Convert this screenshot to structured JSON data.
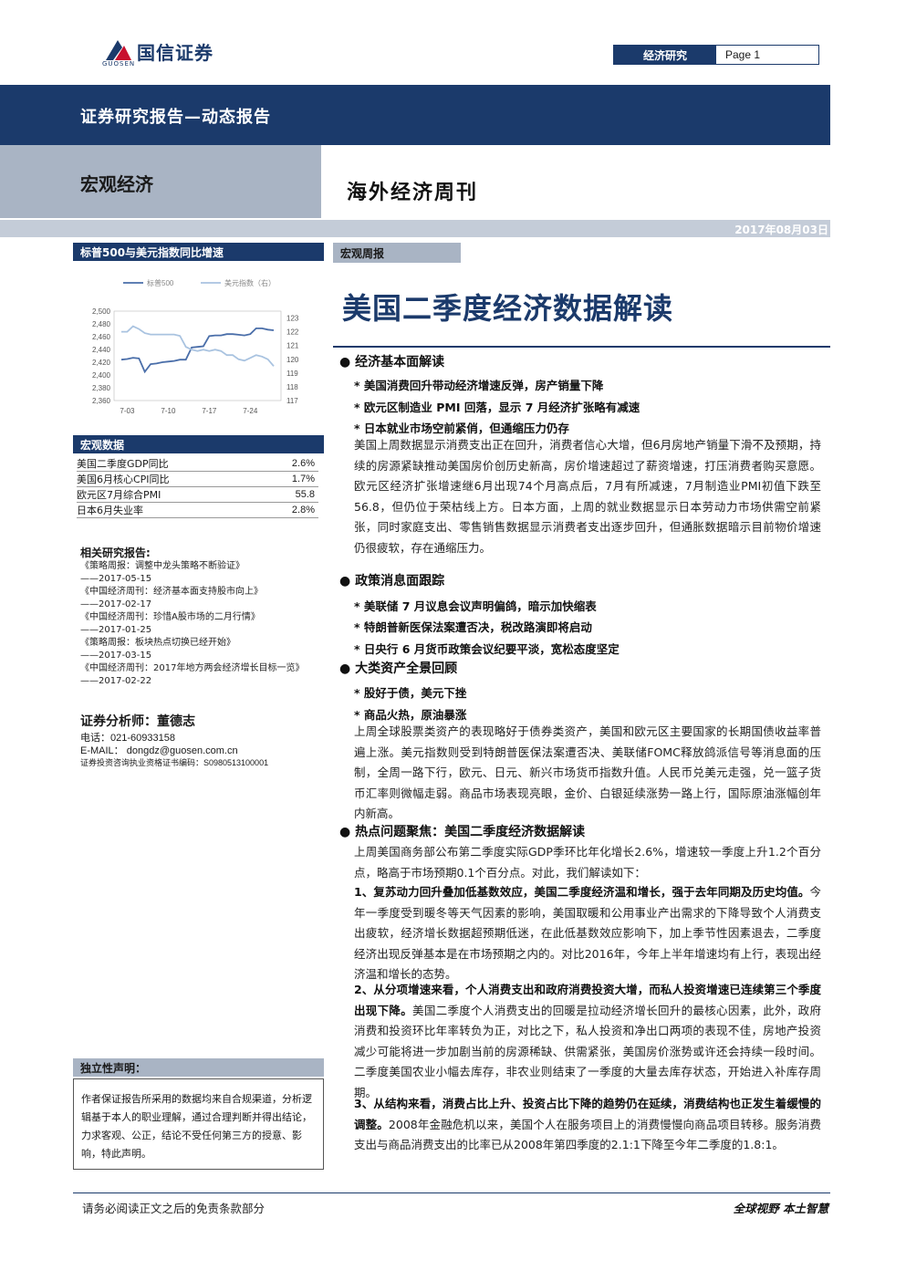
{
  "header": {
    "logo_text": "国信证券",
    "logo_sub": "GUOSEN",
    "tag_label": "经济研究",
    "page_label": "Page 1",
    "band_title": "证券研究报告—动态报告",
    "sector": "宏观经济",
    "series_title": "海外经济周刊",
    "date": "2017年08月03日"
  },
  "colors": {
    "navy": "#1b3a6b",
    "grey_band": "#a9b4c4",
    "spx_line": "#4a6ea9",
    "usd_line": "#a9c3e0"
  },
  "chart_section": {
    "title": "标普500与美元指数同比增速"
  },
  "chart_data": {
    "type": "line",
    "x_ticks": [
      "7-03",
      "7-10",
      "7-17",
      "7-24"
    ],
    "y_left_ticks": [
      "2,500",
      "2,480",
      "2,460",
      "2,440",
      "2,420",
      "2,400",
      "2,380",
      "2,360"
    ],
    "y_right_ticks": [
      "123",
      "122",
      "121",
      "120",
      "119",
      "118",
      "117"
    ],
    "ylim_left": [
      2360,
      2500
    ],
    "ylim_right": [
      117,
      123.5
    ],
    "series": [
      {
        "name": "标普500",
        "axis": "left",
        "values": [
          2424,
          2425,
          2427,
          2426,
          2405,
          2417,
          2418,
          2420,
          2421,
          2422,
          2424,
          2424,
          2443,
          2444,
          2445,
          2461,
          2462,
          2462,
          2464,
          2464,
          2463,
          2462,
          2464,
          2473,
          2473,
          2471,
          2470
        ]
      },
      {
        "name": "美元指数（右）",
        "axis": "right",
        "values": [
          122.0,
          122.0,
          122.4,
          122.2,
          121.9,
          121.8,
          121.8,
          121.8,
          121.8,
          121.8,
          121.7,
          120.9,
          120.7,
          120.6,
          120.7,
          120.6,
          120.7,
          120.6,
          120.3,
          120.3,
          120.0,
          119.9,
          120.1,
          120.3,
          120.2,
          120.0,
          119.5
        ]
      }
    ],
    "legend_position": "top"
  },
  "macro": {
    "title": "宏观数据",
    "rows": [
      {
        "label": "美国二季度GDP同比",
        "value": "2.6%"
      },
      {
        "label": "美国6月核心CPI同比",
        "value": "1.7%"
      },
      {
        "label": "欧元区7月综合PMI",
        "value": "55.8"
      },
      {
        "label": "日本6月失业率",
        "value": "2.8%"
      }
    ]
  },
  "related": {
    "title": "相关研究报告:",
    "items": [
      {
        "title": "《策略周报：调整中龙头策略不断验证》",
        "date": "——2017-05-15"
      },
      {
        "title": "《中国经济周刊：经济基本面支持股市向上》",
        "date": "——2017-02-17"
      },
      {
        "title": "《中国经济周刊：珍惜A股市场的二月行情》",
        "date": "——2017-01-25"
      },
      {
        "title": "《策略周报：板块热点切换已经开始》",
        "date": "——2017-03-15"
      },
      {
        "title": "《中国经济周刊：2017年地方两会经济增长目标一览》",
        "date": "——2017-02-22"
      }
    ]
  },
  "analyst": {
    "title": "证券分析师：董德志",
    "phone": "电话：021-60933158",
    "email": "E-MAIL：  dongdz@guosen.com.cn",
    "cert": "证券投资咨询执业资格证书编码：S0980513100001"
  },
  "declaration": {
    "title": "独立性声明：",
    "text": "作者保证报告所采用的数据均来自合规渠道，分析逻辑基于本人的职业理解，通过合理判断并得出结论，力求客观、公正，结论不受任何第三方的授意、影响，特此声明。"
  },
  "main": {
    "tag": "宏观周报",
    "headline": "美国二季度经济数据解读",
    "s1": {
      "title": "● 经济基本面解读",
      "b1": "* 美国消费回升带动经济增速反弹，房产销量下降",
      "b2": "* 欧元区制造业 PMI 回落，显示 7 月经济扩张略有减速",
      "b3": "* 日本就业市场空前紧俏，但通缩压力仍存",
      "p": "美国上周数据显示消费支出正在回升，消费者信心大增，但6月房地产销量下滑不及预期，持续的房源紧缺推动美国房价创历史新高，房价增速超过了薪资增速，打压消费者购买意愿。欧元区经济扩张增速继6月出现74个月高点后，7月有所减速，7月制造业PMI初值下跌至56.8，但仍位于荣枯线上方。日本方面，上周的就业数据显示日本劳动力市场供需空前紧张，同时家庭支出、零售销售数据显示消费者支出逐步回升，但通胀数据暗示目前物价增速仍很疲软，存在通缩压力。"
    },
    "s2": {
      "title": "● 政策消息面跟踪",
      "b1": "* 美联储 7 月议息会议声明偏鸽，暗示加快缩表",
      "b2": "* 特朗普新医保法案遭否决，税改路演即将启动",
      "b3": "* 日央行 6 月货币政策会议纪要平淡，宽松态度坚定"
    },
    "s3": {
      "title": "● 大类资产全景回顾",
      "b1": "* 股好于债，美元下挫",
      "b2": "* 商品火热，原油暴涨",
      "p": "上周全球股票类资产的表现略好于债券类资产，美国和欧元区主要国家的长期国债收益率普遍上涨。美元指数则受到特朗普医保法案遭否决、美联储FOMC释放鸽派信号等消息面的压制，全周一路下行，欧元、日元、新兴市场货币指数升值。人民币兑美元走强，兑一篮子货币汇率则微幅走弱。商品市场表现亮眼，金价、白银延续涨势一路上行，国际原油涨幅创年内新高。"
    },
    "s4": {
      "title": "● 热点问题聚焦：美国二季度经济数据解读",
      "p0": "上周美国商务部公布第二季度实际GDP季环比年化增长2.6%，增速较一季度上升1.2个百分点，略高于市场预期0.1个百分点。对此，我们解读如下：",
      "p1_bold": "1、复苏动力回升叠加低基数效应，美国二季度经济温和增长，强于去年同期及历史均值。",
      "p1": "今年一季度受到暖冬等天气因素的影响，美国取暖和公用事业产出需求的下降导致个人消费支出疲软，经济增长数据超预期低迷，在此低基数效应影响下，加上季节性因素退去，二季度经济出现反弹基本是在市场预期之内的。对比2016年，今年上半年增速均有上行，表现出经济温和增长的态势。",
      "p2_bold": "2、从分项增速来看，个人消费支出和政府消费投资大增，而私人投资增速已连续第三个季度出现下降。",
      "p2": "美国二季度个人消费支出的回暖是拉动经济增长回升的最核心因素，此外，政府消费和投资环比年率转负为正，对比之下，私人投资和净出口两项的表现不佳，房地产投资减少可能将进一步加剧当前的房源稀缺、供需紧张，美国房价涨势或许还会持续一段时间。二季度美国农业小幅去库存，非农业则结束了一季度的大量去库存状态，开始进入补库存周期。",
      "p3_bold": "3、从结构来看，消费占比上升、投资占比下降的趋势仍在延续，消费结构也正发生着缓慢的调整。",
      "p3": "2008年金融危机以来，美国个人在服务项目上的消费慢慢向商品项目转移。服务消费支出与商品消费支出的比率已从2008年第四季度的2.1:1下降至今年二季度的1.8:1。"
    }
  },
  "footer": {
    "left": "请务必阅读正文之后的免责条款部分",
    "right": "全球视野  本土智慧"
  }
}
